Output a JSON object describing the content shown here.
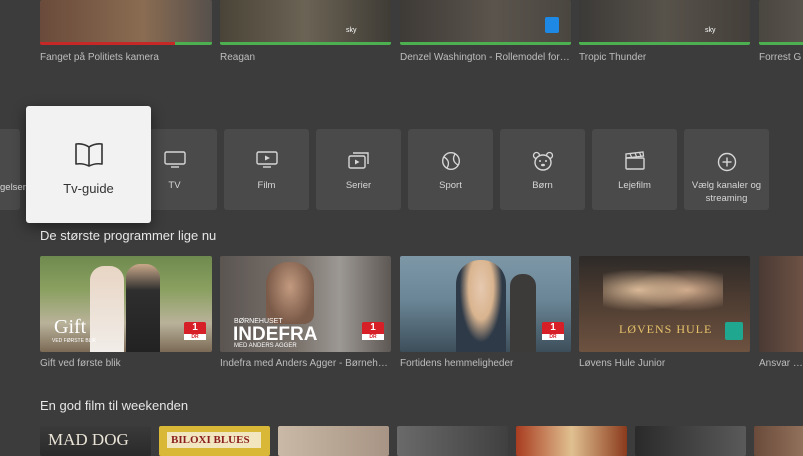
{
  "top_row": {
    "captions": [
      "Fanget på Politiets kamera",
      "Reagan",
      "Denzel Washington - Rollemodel for e...",
      "Tropic Thunder",
      "Forrest G"
    ],
    "channel_marks": [
      "sky",
      "sky",
      "sky"
    ]
  },
  "categories": {
    "focused_label": "Tv-guide",
    "partial_left_label": "gelser",
    "items": [
      {
        "label": "TV",
        "icon": "tv-icon"
      },
      {
        "label": "Film",
        "icon": "play-screen-icon"
      },
      {
        "label": "Serier",
        "icon": "series-icon"
      },
      {
        "label": "Sport",
        "icon": "ball-icon"
      },
      {
        "label": "Børn",
        "icon": "bear-icon"
      },
      {
        "label": "Lejefilm",
        "icon": "clapper-icon"
      },
      {
        "label": "Vælg kanaler og streaming",
        "icon": "plus-icon"
      }
    ]
  },
  "section_now": {
    "heading": "De største programmer lige nu",
    "items": [
      {
        "caption": "Gift ved første blik",
        "overlay_title": "Gift",
        "overlay_sub": "VED FØRSTE BLIK",
        "badge": "1",
        "badge_sub": "DR"
      },
      {
        "caption": "Indefra med Anders Agger - Børnehus...",
        "overlay_kicker": "BØRNEHUSET",
        "overlay_title": "INDEFRA",
        "overlay_sub": "MED ANDERS AGGER",
        "badge": "1",
        "badge_sub": "DR"
      },
      {
        "caption": "Fortidens hemmeligheder",
        "badge": "1",
        "badge_sub": "DR"
      },
      {
        "caption": "Løvens Hule Junior",
        "overlay_title": "LØVENS HULE",
        "badge": "ramasjang",
        "badge_sub": "DR"
      },
      {
        "caption": "Ansvar for"
      }
    ]
  },
  "section_weekend": {
    "heading": "En god film til weekenden",
    "items": [
      {
        "overlay_title": "MAD DOG"
      },
      {
        "overlay_title": "BILOXI BLUES"
      },
      {
        "overlay_title": ""
      },
      {
        "overlay_title": ""
      },
      {
        "overlay_title": ""
      },
      {
        "overlay_title": ""
      },
      {
        "overlay_title": ""
      }
    ]
  },
  "colors": {
    "background": "#3c3c3c",
    "tile": "#4a4a4a",
    "focus_tile": "#f2f2f2",
    "progress": "#4caf50",
    "dr_red": "#d61f26"
  }
}
